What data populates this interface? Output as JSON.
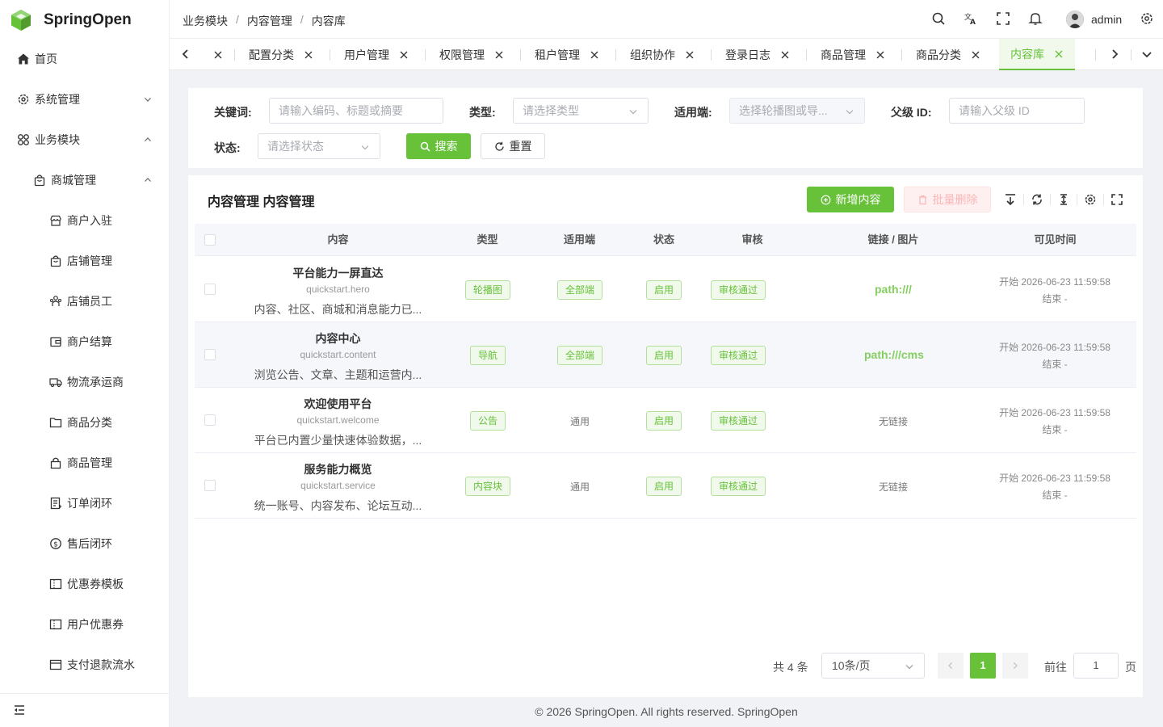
{
  "app": {
    "name": "SpringOpen"
  },
  "sidebar": {
    "items": [
      {
        "label": "首页",
        "icon": "home-icon"
      },
      {
        "label": "系统管理",
        "icon": "gear-icon"
      },
      {
        "label": "业务模块",
        "icon": "grid-icon"
      },
      {
        "label": "商城管理",
        "icon": "bag-icon"
      },
      {
        "label": "商户入驻",
        "icon": "shop-icon"
      },
      {
        "label": "店铺管理",
        "icon": "bag-icon"
      },
      {
        "label": "店铺员工",
        "icon": "users-icon"
      },
      {
        "label": "商户结算",
        "icon": "wallet-icon"
      },
      {
        "label": "物流承运商",
        "icon": "truck-icon"
      },
      {
        "label": "商品分类",
        "icon": "folder-icon"
      },
      {
        "label": "商品管理",
        "icon": "lock-bag-icon"
      },
      {
        "label": "订单闭环",
        "icon": "document-icon"
      },
      {
        "label": "售后闭环",
        "icon": "money-icon"
      },
      {
        "label": "优惠券模板",
        "icon": "ticket-icon"
      },
      {
        "label": "用户优惠券",
        "icon": "ticket-icon"
      },
      {
        "label": "支付退款流水",
        "icon": "card-icon"
      }
    ]
  },
  "header": {
    "breadcrumb": [
      "业务模块",
      "内容管理",
      "内容库"
    ],
    "breadcrumb_sep": "/",
    "user": "admin"
  },
  "tabs": [
    {
      "label": "配置分类"
    },
    {
      "label": "用户管理"
    },
    {
      "label": "权限管理"
    },
    {
      "label": "租户管理"
    },
    {
      "label": "组织协作"
    },
    {
      "label": "登录日志"
    },
    {
      "label": "商品管理"
    },
    {
      "label": "商品分类"
    },
    {
      "label": "内容库",
      "active": true
    }
  ],
  "search": {
    "keyword_label": "关键词:",
    "keyword_placeholder": "请输入编码、标题或摘要",
    "type_label": "类型:",
    "type_placeholder": "请选择类型",
    "platform_label": "适用端:",
    "platform_placeholder": "选择轮播图或导...",
    "parent_label": "父级 ID:",
    "parent_placeholder": "请输入父级 ID",
    "status_label": "状态:",
    "status_placeholder": "请选择状态",
    "search_btn": "搜索",
    "reset_btn": "重置"
  },
  "table": {
    "title": "内容管理 内容管理",
    "add_btn": "新增内容",
    "batch_delete_btn": "批量删除",
    "columns": [
      "内容",
      "类型",
      "适用端",
      "状态",
      "审核",
      "链接 / 图片",
      "可见时间"
    ],
    "rows": [
      {
        "title": "平台能力一屏直达",
        "code": "quickstart.hero",
        "summary": "内容、社区、商城和消息能力已...",
        "type": "轮播图",
        "platform": "全部端",
        "platform_tag": true,
        "status": "启用",
        "review": "审核通过",
        "link": "path:///",
        "link_is_url": true,
        "start": "开始 2026-06-23 11:59:58",
        "end": "结束 -"
      },
      {
        "title": "内容中心",
        "code": "quickstart.content",
        "summary": "浏览公告、文章、主题和运营内...",
        "type": "导航",
        "platform": "全部端",
        "platform_tag": true,
        "status": "启用",
        "review": "审核通过",
        "link": "path:///cms",
        "link_is_url": true,
        "start": "开始 2026-06-23 11:59:58",
        "end": "结束 -"
      },
      {
        "title": "欢迎使用平台",
        "code": "quickstart.welcome",
        "summary": "平台已内置少量快速体验数据，...",
        "type": "公告",
        "platform": "通用",
        "platform_tag": false,
        "status": "启用",
        "review": "审核通过",
        "link": "无链接",
        "link_is_url": false,
        "start": "开始 2026-06-23 11:59:58",
        "end": "结束 -"
      },
      {
        "title": "服务能力概览",
        "code": "quickstart.service",
        "summary": "统一账号、内容发布、论坛互动...",
        "type": "内容块",
        "platform": "通用",
        "platform_tag": false,
        "status": "启用",
        "review": "审核通过",
        "link": "无链接",
        "link_is_url": false,
        "start": "开始 2026-06-23 11:59:58",
        "end": "结束 -"
      }
    ]
  },
  "pagination": {
    "total": "共 4 条",
    "page_size": "10条/页",
    "current": "1",
    "goto_label": "前往",
    "goto_value": "1",
    "page_suffix": "页"
  },
  "footer": {
    "text": "© 2026 SpringOpen. All rights reserved. SpringOpen"
  },
  "colors": {
    "accent": "#67c23a",
    "tag_border": "#b3e19d",
    "tag_bg": "#f0f9eb",
    "link": "#85ce61"
  }
}
